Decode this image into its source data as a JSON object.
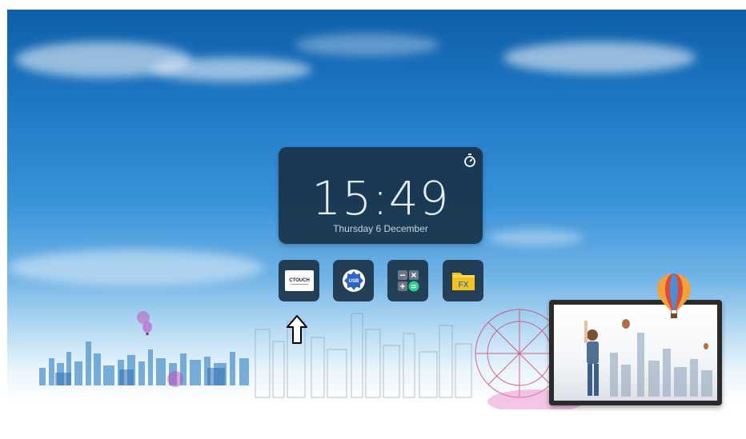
{
  "clock": {
    "time": "15:49",
    "date": "Thursday 6 December",
    "timer_icon": "stopwatch-icon"
  },
  "apps": [
    {
      "name": "ctouch-app",
      "icon": "ctouch-logo-icon",
      "logo_text": "CTOUCH"
    },
    {
      "name": "usb-app",
      "icon": "usb-badge-icon",
      "logo_text": "USB"
    },
    {
      "name": "calculator-app",
      "icon": "calculator-icon"
    },
    {
      "name": "file-manager-app",
      "icon": "folder-icon",
      "logo_text": "FX"
    }
  ],
  "colors": {
    "tile_bg": "#1a3246",
    "clock_bg": "#183249",
    "calc_green": "#2ecf8a",
    "folder_yellow": "#f7c21a",
    "usb_blue": "#2f63c4"
  }
}
